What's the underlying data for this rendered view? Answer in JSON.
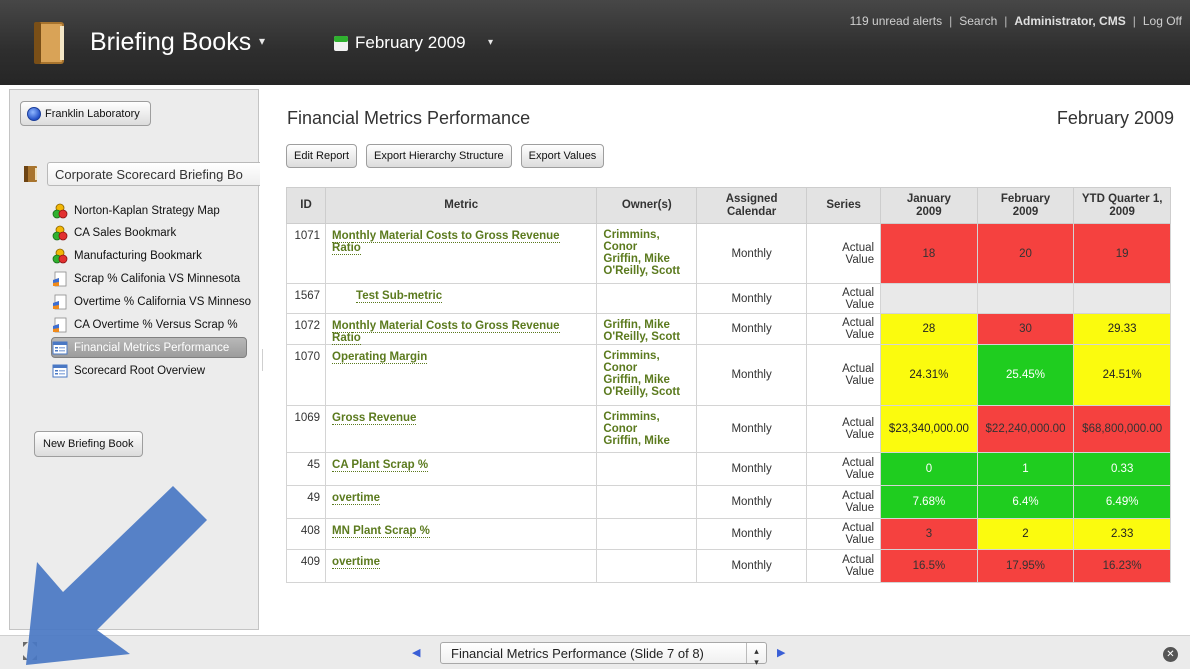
{
  "header": {
    "app_title": "Briefing Books",
    "period": "February 2009",
    "links": {
      "alerts": "119 unread alerts",
      "search": "Search",
      "user": "Administrator, CMS",
      "logoff": "Log Off",
      "separator": "|"
    }
  },
  "sidebar": {
    "org_button": "Franklin Laboratory",
    "book_name": "Corporate Scorecard Briefing Bo",
    "items": [
      {
        "label": "Norton-Kaplan Strategy Map",
        "icon": "bookmark-circles-icon"
      },
      {
        "label": "CA Sales Bookmark",
        "icon": "bookmark-circles-icon"
      },
      {
        "label": "Manufacturing Bookmark",
        "icon": "bookmark-circles-icon"
      },
      {
        "label": "Scrap % Califonia VS Minnesota",
        "icon": "chart-doc-icon"
      },
      {
        "label": "Overtime % California VS Minneso",
        "icon": "chart-doc-icon"
      },
      {
        "label": "CA Overtime % Versus Scrap %",
        "icon": "chart-doc-icon"
      },
      {
        "label": "Financial Metrics Performance",
        "icon": "scorecard-icon",
        "selected": true
      },
      {
        "label": "Scorecard Root Overview",
        "icon": "scorecard-icon"
      }
    ],
    "new_book_button": "New Briefing Book"
  },
  "main": {
    "title": "Financial Metrics Performance",
    "date": "February 2009",
    "buttons": {
      "edit": "Edit Report",
      "export_hierarchy": "Export Hierarchy Structure",
      "export_values": "Export Values"
    },
    "columns": {
      "id": "ID",
      "metric": "Metric",
      "owners": "Owner(s)",
      "calendar_1": "Assigned",
      "calendar_2": "Calendar",
      "series": "Series",
      "jan_1": "January",
      "jan_2": "2009",
      "feb_1": "February",
      "feb_2": "2009",
      "ytd_1": "YTD Quarter 1,",
      "ytd_2": "2009"
    },
    "rows": [
      {
        "id": "1071",
        "metric": "Monthly Material Costs to Gross Revenue Ratio",
        "owners": [
          "Crimmins,",
          "Conor",
          "Griffin, Mike",
          "O'Reilly, Scott"
        ],
        "calendar": "Monthly",
        "series_1": "Actual",
        "series_2": "Value",
        "values": [
          {
            "v": "18",
            "c": "red"
          },
          {
            "v": "20",
            "c": "red"
          },
          {
            "v": "19",
            "c": "red"
          }
        ]
      },
      {
        "id": "1567",
        "metric": "Test Sub-metric",
        "indent": true,
        "owners": [],
        "calendar": "Monthly",
        "series_1": "Actual",
        "series_2": "Value",
        "values": [
          {
            "v": "",
            "c": "grey"
          },
          {
            "v": "",
            "c": "grey"
          },
          {
            "v": "",
            "c": "grey"
          }
        ]
      },
      {
        "id": "1072",
        "metric": "Monthly Material Costs to Gross Revenue Ratio",
        "owners": [
          "Griffin, Mike",
          "O'Reilly, Scott"
        ],
        "calendar": "Monthly",
        "series_1": "Actual",
        "series_2": "Value",
        "values": [
          {
            "v": "28",
            "c": "yellow"
          },
          {
            "v": "30",
            "c": "red"
          },
          {
            "v": "29.33",
            "c": "yellow"
          }
        ]
      },
      {
        "id": "1070",
        "metric": "Operating Margin",
        "owners": [
          "Crimmins,",
          "Conor",
          "Griffin, Mike",
          "O'Reilly, Scott"
        ],
        "calendar": "Monthly",
        "series_1": "Actual",
        "series_2": "Value",
        "values": [
          {
            "v": "24.31%",
            "c": "yellow"
          },
          {
            "v": "25.45%",
            "c": "green"
          },
          {
            "v": "24.51%",
            "c": "yellow"
          }
        ]
      },
      {
        "id": "1069",
        "metric": "Gross Revenue",
        "owners": [
          "Crimmins,",
          "Conor",
          "Griffin, Mike"
        ],
        "calendar": "Monthly",
        "series_1": "Actual",
        "series_2": "Value",
        "values": [
          {
            "v": "$23,340,000.00",
            "c": "yellow"
          },
          {
            "v": "$22,240,000.00",
            "c": "red"
          },
          {
            "v": "$68,800,000.00",
            "c": "red"
          }
        ]
      },
      {
        "id": "45",
        "metric": "CA Plant Scrap %",
        "owners": [],
        "calendar": "Monthly",
        "series_1": "Actual",
        "series_2": "Value",
        "values": [
          {
            "v": "0",
            "c": "green"
          },
          {
            "v": "1",
            "c": "green"
          },
          {
            "v": "0.33",
            "c": "green"
          }
        ]
      },
      {
        "id": "49",
        "metric": "overtime",
        "owners": [],
        "calendar": "Monthly",
        "series_1": "Actual",
        "series_2": "Value",
        "values": [
          {
            "v": "7.68%",
            "c": "green"
          },
          {
            "v": "6.4%",
            "c": "green"
          },
          {
            "v": "6.49%",
            "c": "green"
          }
        ]
      },
      {
        "id": "408",
        "metric": "MN Plant Scrap %",
        "owners": [],
        "calendar": "Monthly",
        "series_1": "Actual",
        "series_2": "Value",
        "values": [
          {
            "v": "3",
            "c": "red"
          },
          {
            "v": "2",
            "c": "yellow"
          },
          {
            "v": "2.33",
            "c": "yellow"
          }
        ]
      },
      {
        "id": "409",
        "metric": "overtime",
        "owners": [],
        "calendar": "Monthly",
        "series_1": "Actual",
        "series_2": "Value",
        "values": [
          {
            "v": "16.5%",
            "c": "red"
          },
          {
            "v": "17.95%",
            "c": "red"
          },
          {
            "v": "16.23%",
            "c": "red"
          }
        ]
      }
    ]
  },
  "bottombar": {
    "slide_select": "Financial Metrics Performance (Slide 7 of 8)"
  },
  "colors": {
    "red": "#f5413f",
    "yellow": "#fbfb0e",
    "green": "#1fcd1f",
    "link_green": "#5b7a1e",
    "annotation_arrow": "#4a78c4"
  }
}
